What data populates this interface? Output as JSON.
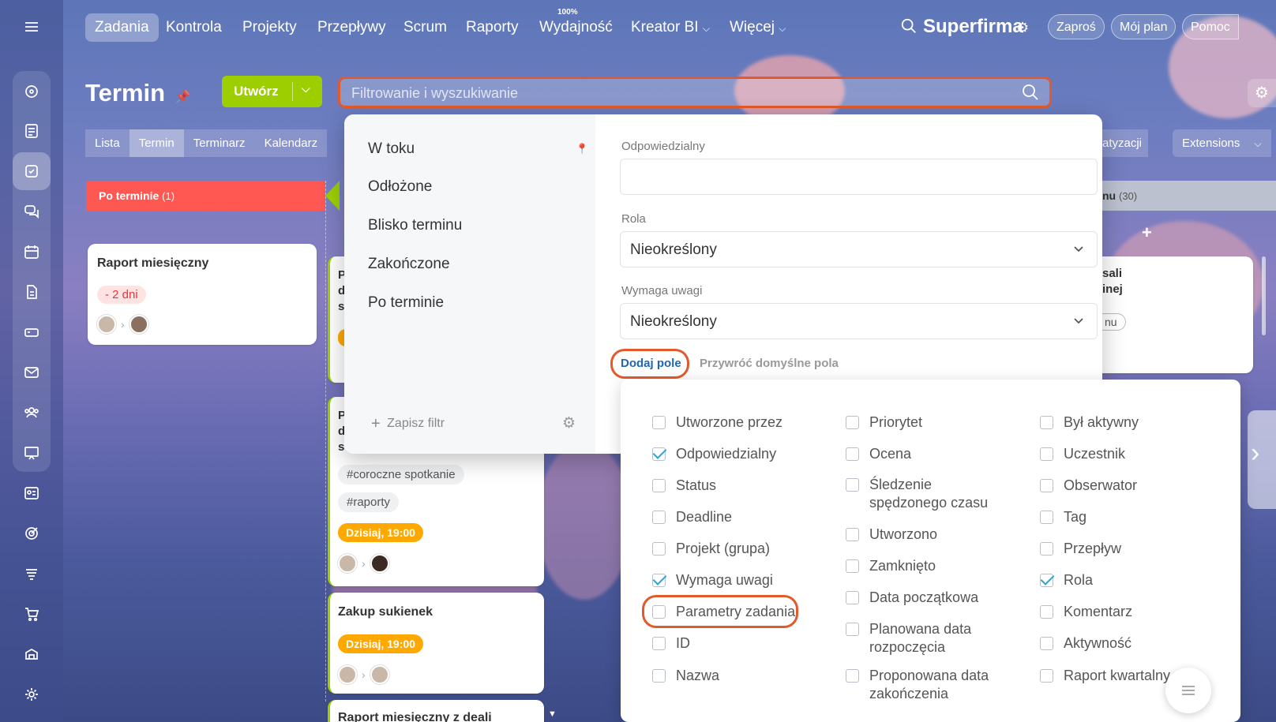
{
  "topnav": {
    "items": [
      "Zadania",
      "Kontrola",
      "Projekty",
      "Przepływy",
      "Scrum",
      "Raporty",
      "Wydajność",
      "Kreator BI",
      "Więcej"
    ],
    "wydajnosc_badge": "100%",
    "company": "Superfirma",
    "invite": "Zaproś",
    "plan": "Mój plan",
    "help": "Pomoc"
  },
  "page": {
    "title": "Termin",
    "create_label": "Utwórz",
    "search_placeholder": "Filtrowanie i wyszukiwanie"
  },
  "views": [
    "Lista",
    "Termin",
    "Terminarz",
    "Kalendarz"
  ],
  "right_toolbar": {
    "automation": "atyzacji",
    "extensions": "Extensions"
  },
  "columns": {
    "overdue": {
      "title": "Po terminie",
      "count": "(1)"
    },
    "right": {
      "title": "nu",
      "count": "(30)"
    }
  },
  "cards": {
    "monthly": {
      "title": "Raport miesięczny",
      "badge": "- 2 dni"
    },
    "tags": [
      "#coroczne spotkanie",
      "#raporty"
    ],
    "today1": "Dzisiaj, 19:00",
    "dresses": {
      "title": "Zakup sukienek",
      "badge": "Dzisiaj, 19:00"
    },
    "monthly_deals": "Raport miesięczny z deali",
    "partial_a": "P",
    "partial_b": "d",
    "partial_c": "s",
    "right_card_l1": "sali",
    "right_card_l2": "inej",
    "right_card_chip": "nu"
  },
  "filter_popup": {
    "presets": [
      "W toku",
      "Odłożone",
      "Blisko terminu",
      "Zakończone",
      "Po terminie"
    ],
    "save_filter": "Zapisz filtr",
    "fields": {
      "responsible_label": "Odpowiedzialny",
      "role_label": "Rola",
      "role_value": "Nieokreślony",
      "attention_label": "Wymaga uwagi",
      "attention_value": "Nieokreślony"
    },
    "add_field": "Dodaj pole",
    "restore_default": "Przywróć domyślne pola"
  },
  "field_options": {
    "col1": [
      {
        "label": "Utworzone przez",
        "checked": false
      },
      {
        "label": "Odpowiedzialny",
        "checked": true
      },
      {
        "label": "Status",
        "checked": false
      },
      {
        "label": "Deadline",
        "checked": false
      },
      {
        "label": "Projekt (grupa)",
        "checked": false
      },
      {
        "label": "Wymaga uwagi",
        "checked": true
      },
      {
        "label": "Parametry zadania",
        "checked": false
      },
      {
        "label": "ID",
        "checked": false
      },
      {
        "label": "Nazwa",
        "checked": false
      }
    ],
    "col2": [
      {
        "label": "Priorytet",
        "checked": false
      },
      {
        "label": "Ocena",
        "checked": false
      },
      {
        "label": "Śledzenie spędzonego czasu",
        "checked": false
      },
      {
        "label": "Utworzono",
        "checked": false
      },
      {
        "label": "Zamknięto",
        "checked": false
      },
      {
        "label": "Data początkowa",
        "checked": false
      },
      {
        "label": "Planowana data rozpoczęcia",
        "checked": false
      },
      {
        "label": "Proponowana data zakończenia",
        "checked": false
      }
    ],
    "col3": [
      {
        "label": "Był aktywny",
        "checked": false
      },
      {
        "label": "Uczestnik",
        "checked": false
      },
      {
        "label": "Obserwator",
        "checked": false
      },
      {
        "label": "Tag",
        "checked": false
      },
      {
        "label": "Przepływ",
        "checked": false
      },
      {
        "label": "Rola",
        "checked": true
      },
      {
        "label": "Komentarz",
        "checked": false
      },
      {
        "label": "Aktywność",
        "checked": false
      },
      {
        "label": "Raport kwartalny",
        "checked": false
      }
    ]
  },
  "colors": {
    "accent_red": "#ff5752",
    "accent_green": "#9dcf00",
    "highlight": "#e25a2c",
    "link_blue": "#2067b0",
    "check_blue": "#2fa4d7"
  }
}
